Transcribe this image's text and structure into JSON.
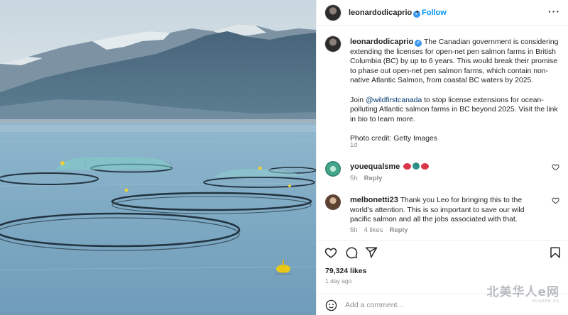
{
  "header": {
    "username": "leonardodicaprio",
    "separator": "•",
    "follow_label": "Follow",
    "more_icon": "more-horizontal-icon"
  },
  "caption": {
    "username": "leonardodicaprio",
    "paragraph1": "The Canadian government is considering extending the licenses for open-net pen salmon farms in British Columbia (BC) by up to 6 years. This would break their promise to phase out open-net pen salmon farms, which contain non-native Atlantic Salmon, from coastal BC waters by 2025.",
    "join_prefix": "Join ",
    "mention": "@wildfirstcanada",
    "join_suffix": " to stop license extensions for ocean-polluting Atlantic salmon farms in BC beyond 2025. Visit the link in bio to learn more.",
    "credit": "Photo credit: Getty Images",
    "time": "1d"
  },
  "comments": [
    {
      "username": "youequalsme",
      "text": "",
      "emojis": [
        "red-heart",
        "teal-circle",
        "red-heart"
      ],
      "time": "5h",
      "likes": "",
      "reply_label": "Reply"
    },
    {
      "username": "melbonetti23",
      "text": "Thank you Leo for bringing this to the world's attention. This is so important to save our wild pacific salmon and all the jobs associated with that.",
      "time": "5h",
      "likes": "4 likes",
      "reply_label": "Reply"
    }
  ],
  "actions": {
    "icons": [
      "heart-icon",
      "comment-icon",
      "share-icon",
      "bookmark-icon"
    ]
  },
  "likes_count": "79,324 likes",
  "post_time": "1 day ago",
  "add_comment": {
    "placeholder": "Add a comment..."
  },
  "watermark": {
    "text": "北美华人e网",
    "subtext": "HUAREN.US"
  },
  "colors": {
    "link": "#0095f6",
    "mention": "#00376b",
    "verified": "#3897f0",
    "meta": "#8e8e8e"
  }
}
